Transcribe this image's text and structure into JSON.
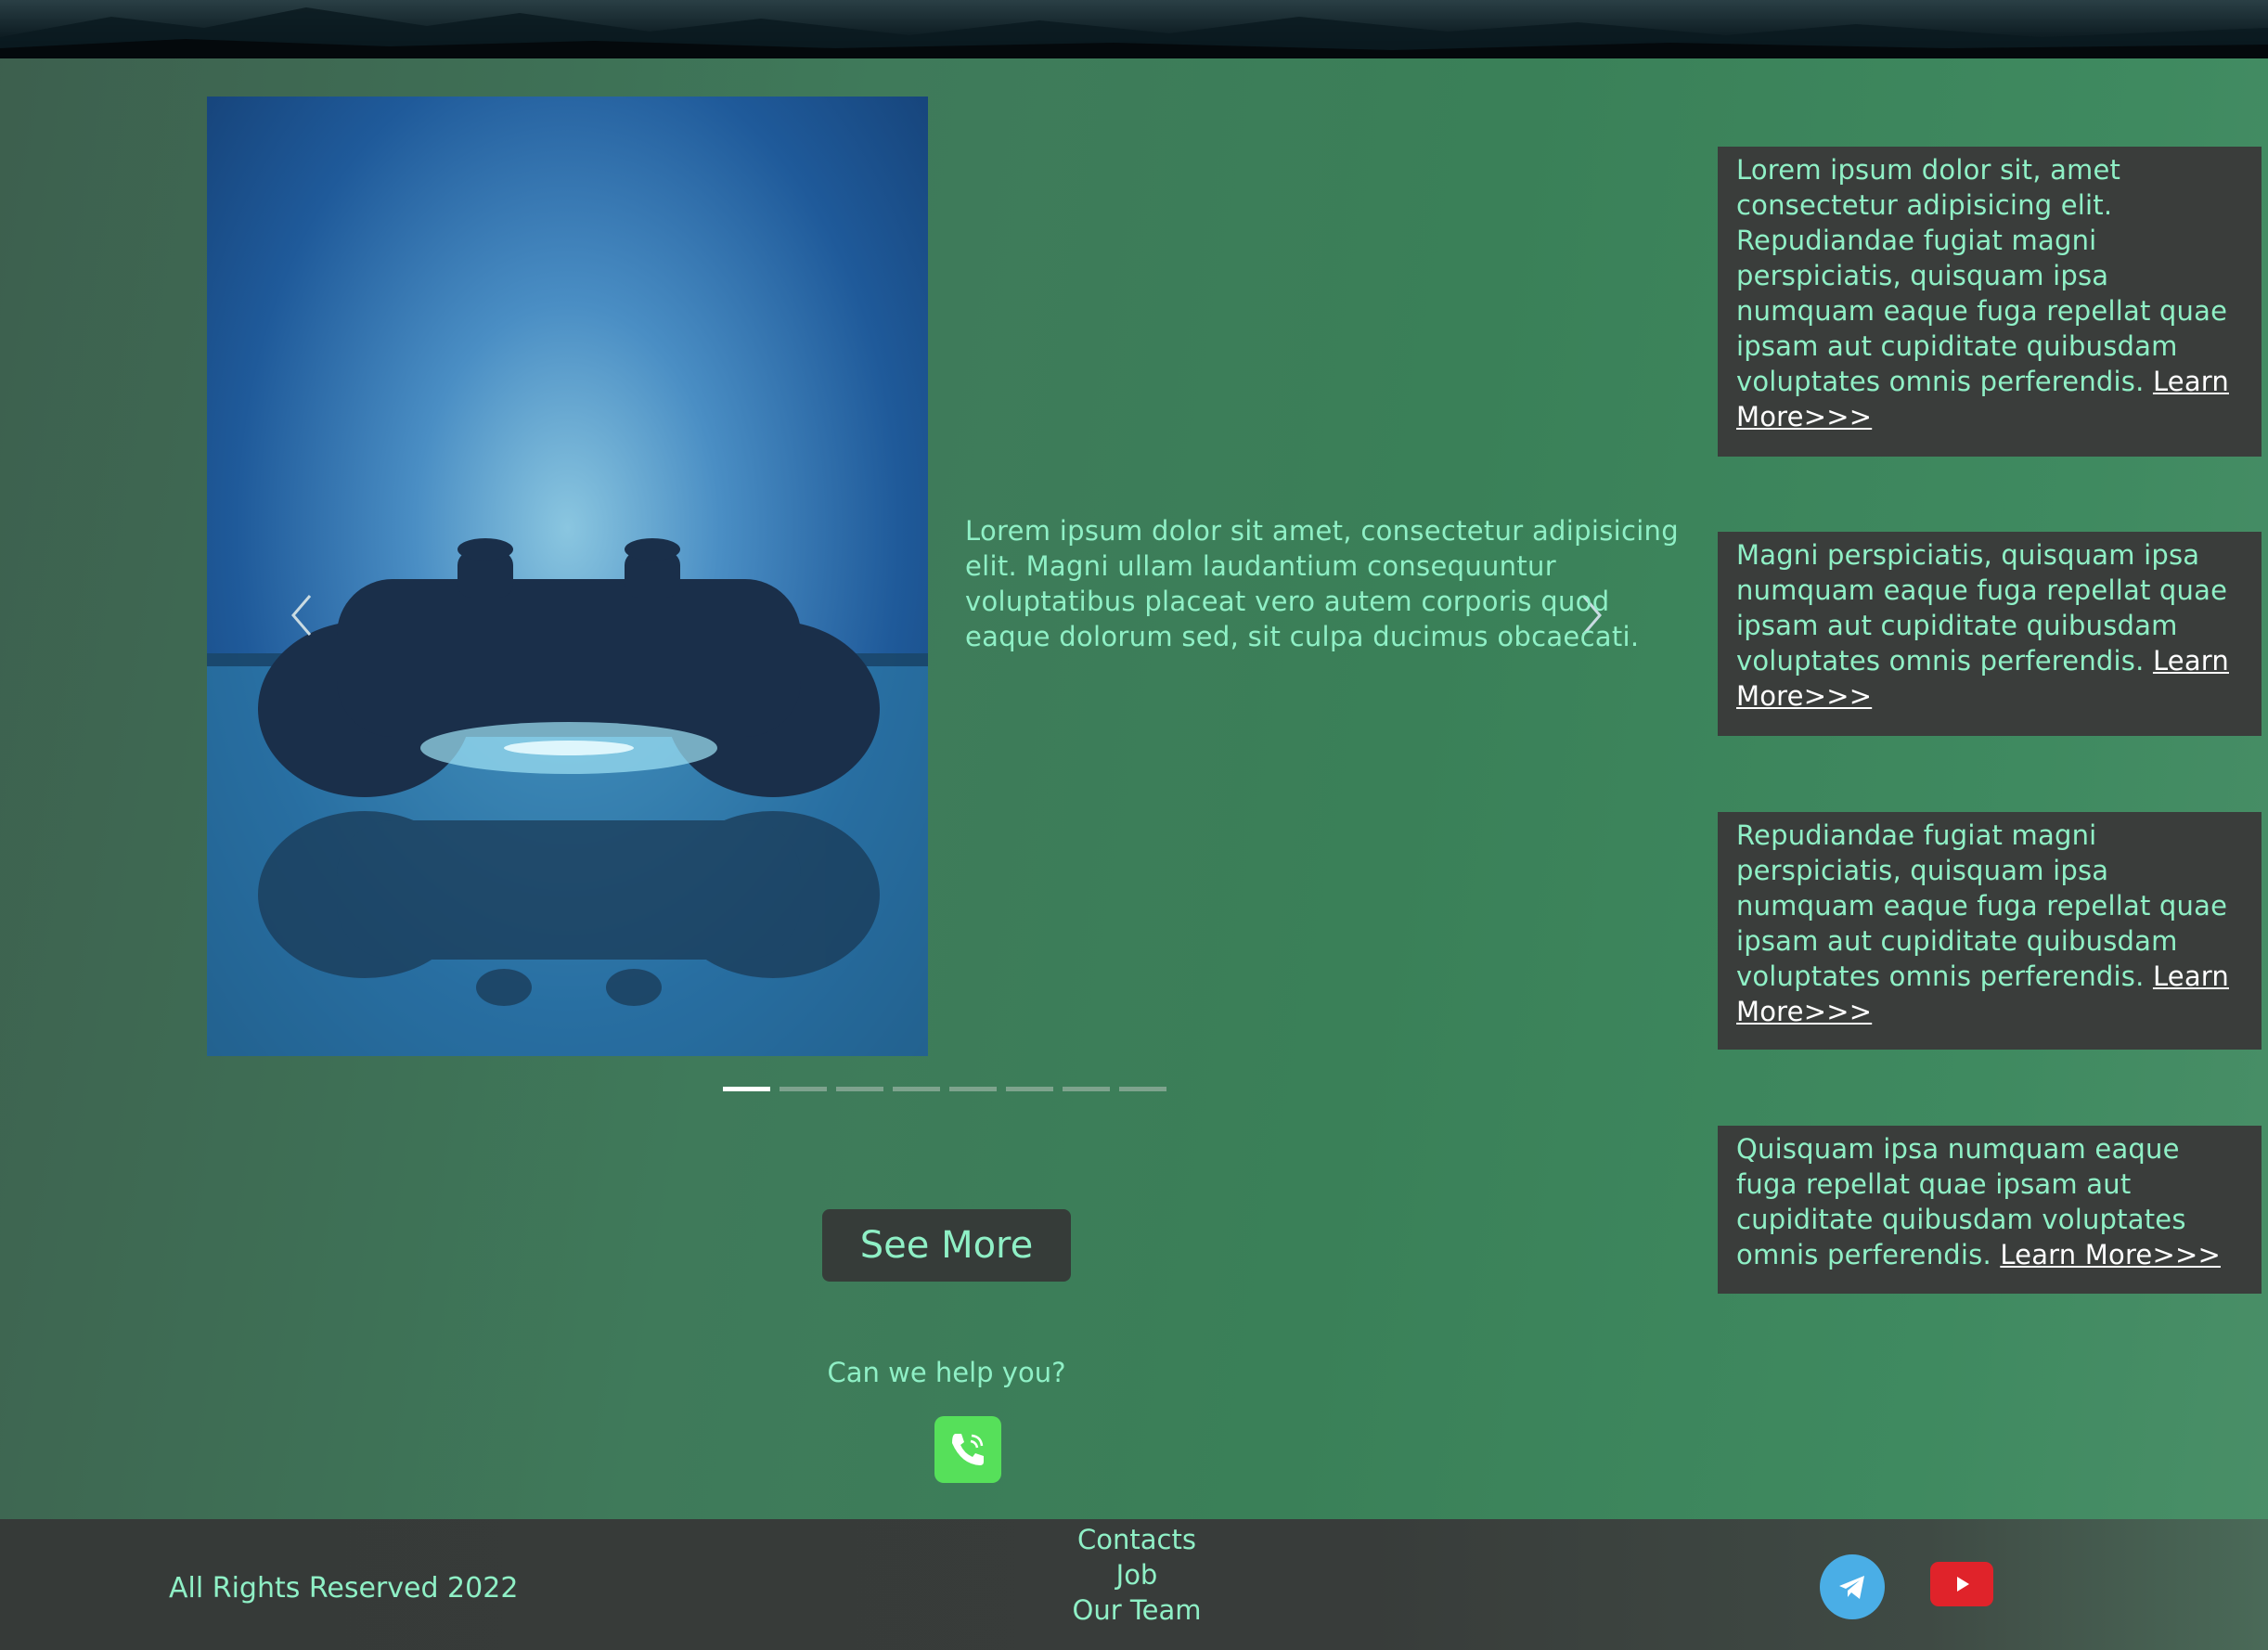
{
  "carousel": {
    "prev_label": "‹",
    "next_label": "›",
    "caption": "Lorem ipsum dolor sit amet, consectetur adipisicing elit. Magni ullam laudantium consequuntur voluptatibus placeat vero autem corporis quod eaque dolorum sed, sit culpa ducimus obcaecati.",
    "slide_count": 8,
    "active_index": 0
  },
  "see_more": {
    "label": "See More"
  },
  "help": {
    "text": "Can we help you?",
    "icon": "phone-icon"
  },
  "side_cards": [
    {
      "text": "Lorem ipsum dolor sit, amet consectetur adipisicing elit. Repudiandae fugiat magni perspiciatis, quisquam ipsa numquam eaque fuga repellat quae ipsam aut cupiditate quibusdam voluptates omnis perferendis. ",
      "link": "Learn More>>>"
    },
    {
      "text": "Magni perspiciatis, quisquam ipsa numquam eaque fuga repellat quae ipsam aut cupiditate quibusdam voluptates omnis perferendis. ",
      "link": "Learn More>>>"
    },
    {
      "text": "Repudiandae fugiat magni perspiciatis, quisquam ipsa numquam eaque fuga repellat quae ipsam aut cupiditate quibusdam voluptates omnis perferendis. ",
      "link": "Learn More>>>"
    },
    {
      "text": "Quisquam ipsa numquam eaque fuga repellat quae ipsam aut cupiditate quibusdam voluptates omnis perferendis. ",
      "link": "Learn More>>>"
    }
  ],
  "footer": {
    "copyright": "All Rights Reserved 2022",
    "links": [
      "Contacts",
      "Job",
      "Our Team"
    ],
    "social": [
      "telegram-icon",
      "youtube-icon"
    ]
  },
  "colors": {
    "text_accent": "#8ff0c6",
    "card_bg": "#3a3d3b",
    "footer_bg": "#383c3a",
    "phone_green": "#56e05a",
    "telegram_blue": "#4aaee6",
    "youtube_red": "#e0232a"
  }
}
